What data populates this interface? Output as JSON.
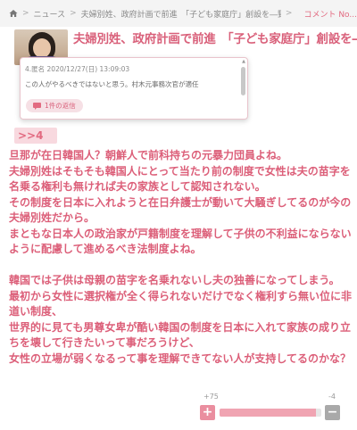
{
  "breadcrumb": {
    "section": "ニュース",
    "article": "夫婦別姓、政府計画で前進　「子ども家庭庁」創設を―野田聖子氏インタ",
    "comment_link": "コメント No..."
  },
  "article": {
    "title": "夫婦別姓、政府計画で前進　「子ども家庭庁」創設を―野田聖子氏インタビュー"
  },
  "popup": {
    "meta": "4.匿名 2020/12/27(日) 13:09:03",
    "body": "この人がやるべきではないと思う。村木元事務次官が適任",
    "replies_label": "1件の返信"
  },
  "comment": {
    "anchor": ">>4",
    "paragraphs": [
      "旦那が在日韓国人？朝鮮人で前科持ちの元暴力団員よね。",
      "夫婦別姓はそもそも韓国人にとって当たり前の制度で女性は夫の苗字を名乗る権利も無ければ夫の家族として認知されない。",
      "その制度を日本に入れようと在日弁護士が動いて大騒ぎしてるのが今の夫婦別姓だから。",
      "まともな日本人の政治家が戸籍制度を理解して子供の不利益にならないように配慮して進めるべき法制度よね。",
      "",
      "韓国では子供は母親の苗字を名乗れないし夫の独善になってしまう。",
      "最初から女性に選択権が全く得られないだけでなく権利すら無い位に非道い制度、",
      "世界的に見ても男尊女卑が酷い韓国の制度を日本に入れて家族の成り立ちを壊して行きたいって事だろうけど、",
      "女性の立場が弱くなるって事を理解できてない人が支持してるのかな？"
    ]
  },
  "votes": {
    "plus_count": "+75",
    "minus_count": "-4",
    "plus_symbol": "+",
    "minus_symbol": "−",
    "plus_fraction": 0.949,
    "plus_color": "#ea8e9f",
    "minus_color": "#a9a9a9"
  },
  "colors": {
    "accent": "#dc5f79",
    "anchor_bg": "#f8d9df"
  }
}
